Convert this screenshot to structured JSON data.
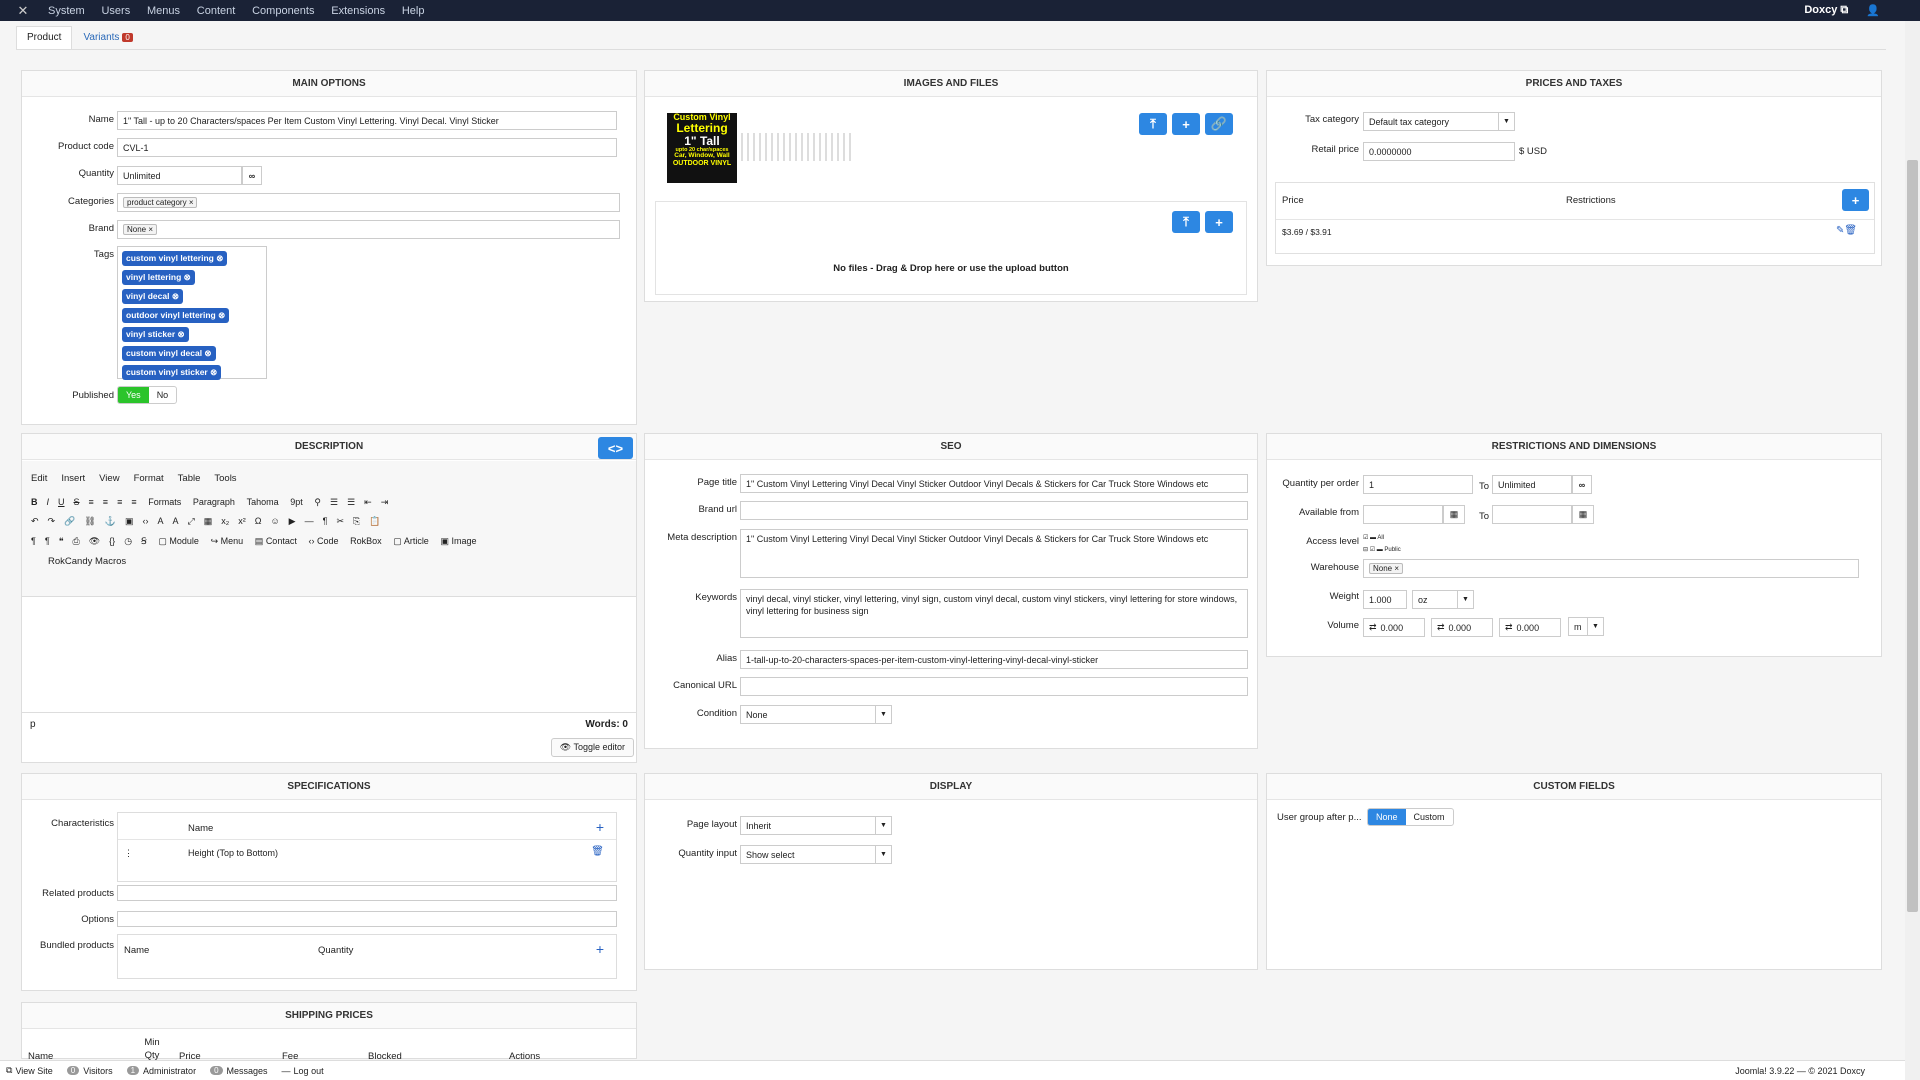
{
  "topbar": {
    "menu": [
      "System",
      "Users",
      "Menus",
      "Content",
      "Components",
      "Extensions",
      "Help"
    ],
    "site": "Doxcy ⧉",
    "user_icon": "user-icon"
  },
  "tabs": {
    "product": "Product",
    "variants": "Variants",
    "variants_count": "0"
  },
  "main_options": {
    "title": "MAIN OPTIONS",
    "name_label": "Name",
    "name_value": "1\" Tall - up to 20 Characters/spaces Per Item Custom Vinyl Lettering. Vinyl Decal. Vinyl Sticker",
    "code_label": "Product code",
    "code_value": "CVL-1",
    "qty_label": "Quantity",
    "qty_value": "Unlimited",
    "cat_label": "Categories",
    "cat_chip": "product category ×",
    "brand_label": "Brand",
    "brand_chip": "None ×",
    "tags_label": "Tags",
    "tags": [
      "custom vinyl lettering",
      "vinyl lettering",
      "vinyl decal",
      "outdoor vinyl lettering",
      "vinyl sticker",
      "custom vinyl decal",
      "custom vinyl sticker"
    ],
    "published_label": "Published",
    "yes": "Yes",
    "no": "No"
  },
  "images": {
    "title": "IMAGES AND FILES",
    "thumb_lines": [
      "Custom Vinyl",
      "Lettering",
      "1\" Tall",
      "upto 20 char/spaces",
      "Car, Window, Wall",
      "OUTDOOR VINYL"
    ],
    "no_files": "No files - Drag & Drop here or use the upload button"
  },
  "prices": {
    "title": "PRICES AND TAXES",
    "tax_label": "Tax category",
    "tax_value": "Default tax category",
    "retail_label": "Retail price",
    "retail_value": "0.0000000",
    "currency": "$ USD",
    "col_price": "Price",
    "col_restrictions": "Restrictions",
    "row_price": "$3.69 / $3.91"
  },
  "description": {
    "title": "DESCRIPTION",
    "menus": [
      "Edit",
      "Insert",
      "View",
      "Format",
      "Table",
      "Tools"
    ],
    "formats": "Formats",
    "paragraph": "Paragraph",
    "font": "Tahoma",
    "size": "9pt",
    "module": "Module",
    "menu": "Menu",
    "contact": "Contact",
    "code": "Code",
    "rokbox": "RokBox",
    "article": "Article",
    "image": "Image",
    "rokcandy": "RokCandy Macros",
    "path": "p",
    "words": "Words: 0",
    "toggle": "Toggle editor"
  },
  "seo": {
    "title": "SEO",
    "page_title_label": "Page title",
    "page_title": "1\" Custom Vinyl Lettering Vinyl Decal Vinyl Sticker Outdoor Vinyl Decals & Stickers for Car Truck Store Windows etc",
    "brand_url_label": "Brand url",
    "meta_label": "Meta description",
    "meta": "1\" Custom Vinyl Lettering Vinyl Decal Vinyl Sticker Outdoor Vinyl Decals & Stickers for Car Truck Store Windows etc",
    "keywords_label": "Keywords",
    "keywords": "vinyl decal, vinyl sticker, vinyl lettering, vinyl sign, custom vinyl decal, custom vinyl stickers, vinyl lettering for store windows, vinyl lettering for business sign",
    "alias_label": "Alias",
    "alias": "1-tall-up-to-20-characters-spaces-per-item-custom-vinyl-lettering-vinyl-decal-vinyl-sticker",
    "canonical_label": "Canonical URL",
    "condition_label": "Condition",
    "condition": "None"
  },
  "restrictions": {
    "title": "RESTRICTIONS AND DIMENSIONS",
    "qpo_label": "Quantity per order",
    "qpo_from": "1",
    "to": "To",
    "qpo_to": "Unlimited",
    "avail_label": "Available from",
    "access_label": "Access level",
    "access_all": "All",
    "access_public": "Public",
    "warehouse_label": "Warehouse",
    "warehouse_chip": "None ×",
    "weight_label": "Weight",
    "weight": "1.000",
    "weight_unit": "oz",
    "volume_label": "Volume",
    "vol": [
      "0.000",
      "0.000",
      "0.000"
    ],
    "vol_unit": "m"
  },
  "specs": {
    "title": "SPECIFICATIONS",
    "char_label": "Characteristics",
    "col_name": "Name",
    "row": "Height (Top to Bottom)",
    "related_label": "Related products",
    "options_label": "Options",
    "bundled_label": "Bundled products",
    "b_name": "Name",
    "b_qty": "Quantity"
  },
  "display": {
    "title": "DISPLAY",
    "layout_label": "Page layout",
    "layout": "Inherit",
    "qty_label": "Quantity input",
    "qty": "Show select"
  },
  "custom": {
    "title": "CUSTOM FIELDS",
    "group_label": "User group after p...",
    "none": "None",
    "custom": "Custom"
  },
  "shipping": {
    "title": "SHIPPING PRICES",
    "cols": [
      "Name",
      "Min Qty",
      "Price",
      "Fee",
      "Blocked",
      "Actions"
    ]
  },
  "footer": {
    "view_site": "View Site",
    "visitors": "Visitors",
    "visitors_n": "0",
    "admin": "Administrator",
    "admin_n": "1",
    "messages": "Messages",
    "messages_n": "0",
    "logout": "Log out",
    "version": "Joomla! 3.9.22 — © 2021 Doxcy"
  }
}
